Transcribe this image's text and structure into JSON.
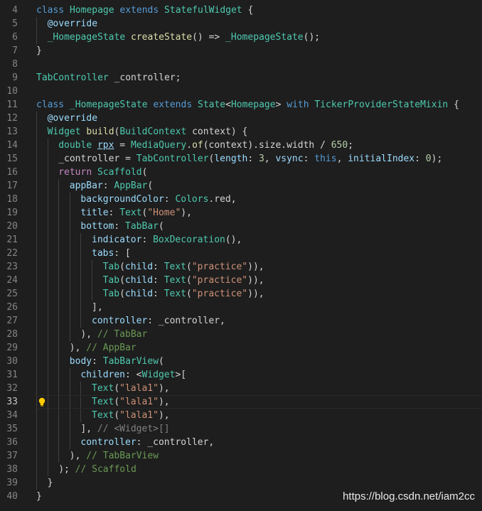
{
  "editor": {
    "theme": "dark",
    "colors": {
      "background": "#1e1e1e",
      "keyword": "#569cd6",
      "control": "#c586c0",
      "class": "#4ec9b0",
      "function": "#dcdcaa",
      "variable": "#9cdcfe",
      "string": "#ce9178",
      "number": "#b5cea8",
      "comment": "#6a9955",
      "hint": "#808080"
    },
    "active_line": 33,
    "lightbulb_icon": "lightbulb-icon",
    "lines": [
      {
        "n": "4",
        "indent": 0,
        "tokens": [
          [
            "keyword",
            "class "
          ],
          [
            "class",
            "Homepage "
          ],
          [
            "keyword",
            "extends "
          ],
          [
            "class",
            "StatefulWidget "
          ],
          [
            "plain",
            "{"
          ]
        ]
      },
      {
        "n": "5",
        "indent": 1,
        "tokens": [
          [
            "anno",
            "@override"
          ]
        ]
      },
      {
        "n": "6",
        "indent": 1,
        "tokens": [
          [
            "class",
            "_HomepageState "
          ],
          [
            "func",
            "createState"
          ],
          [
            "plain",
            "() => "
          ],
          [
            "class",
            "_HomepageState"
          ],
          [
            "plain",
            "();"
          ]
        ]
      },
      {
        "n": "7",
        "indent": 0,
        "tokens": [
          [
            "plain",
            "}"
          ]
        ]
      },
      {
        "n": "8",
        "indent": 0,
        "tokens": []
      },
      {
        "n": "9",
        "indent": 0,
        "tokens": [
          [
            "class",
            "TabController "
          ],
          [
            "plain",
            "_controller;"
          ]
        ]
      },
      {
        "n": "10",
        "indent": 0,
        "tokens": []
      },
      {
        "n": "11",
        "indent": 0,
        "tokens": [
          [
            "keyword",
            "class "
          ],
          [
            "class",
            "_HomepageState "
          ],
          [
            "keyword",
            "extends "
          ],
          [
            "class",
            "State"
          ],
          [
            "plain",
            "<"
          ],
          [
            "class",
            "Homepage"
          ],
          [
            "plain",
            "> "
          ],
          [
            "keyword",
            "with "
          ],
          [
            "class",
            "TickerProviderStateMixin "
          ],
          [
            "plain",
            "{"
          ]
        ]
      },
      {
        "n": "12",
        "indent": 1,
        "tokens": [
          [
            "anno",
            "@override"
          ]
        ]
      },
      {
        "n": "13",
        "indent": 1,
        "tokens": [
          [
            "class",
            "Widget "
          ],
          [
            "func",
            "build"
          ],
          [
            "plain",
            "("
          ],
          [
            "class",
            "BuildContext "
          ],
          [
            "plain",
            "context) {"
          ]
        ]
      },
      {
        "n": "14",
        "indent": 2,
        "tokens": [
          [
            "class",
            "double "
          ],
          [
            "var",
            "rpx"
          ],
          [
            "plain",
            " = "
          ],
          [
            "class",
            "MediaQuery"
          ],
          [
            "plain",
            "."
          ],
          [
            "func",
            "of"
          ],
          [
            "plain",
            "(context).size.width / "
          ],
          [
            "number",
            "650"
          ],
          [
            "plain",
            ";"
          ]
        ]
      },
      {
        "n": "15",
        "indent": 2,
        "tokens": [
          [
            "plain",
            "_controller = "
          ],
          [
            "class",
            "TabController"
          ],
          [
            "plain",
            "("
          ],
          [
            "var",
            "length"
          ],
          [
            "plain",
            ": "
          ],
          [
            "number",
            "3"
          ],
          [
            "plain",
            ", "
          ],
          [
            "var",
            "vsync"
          ],
          [
            "plain",
            ": "
          ],
          [
            "keyword",
            "this"
          ],
          [
            "plain",
            ", "
          ],
          [
            "var",
            "initialIndex"
          ],
          [
            "plain",
            ": "
          ],
          [
            "number",
            "0"
          ],
          [
            "plain",
            ");"
          ]
        ]
      },
      {
        "n": "16",
        "indent": 2,
        "tokens": [
          [
            "control",
            "return "
          ],
          [
            "class",
            "Scaffold"
          ],
          [
            "plain",
            "("
          ]
        ]
      },
      {
        "n": "17",
        "indent": 3,
        "tokens": [
          [
            "var",
            "appBar"
          ],
          [
            "plain",
            ": "
          ],
          [
            "class",
            "AppBar"
          ],
          [
            "plain",
            "("
          ]
        ]
      },
      {
        "n": "18",
        "indent": 4,
        "tokens": [
          [
            "var",
            "backgroundColor"
          ],
          [
            "plain",
            ": "
          ],
          [
            "class",
            "Colors"
          ],
          [
            "plain",
            ".red,"
          ]
        ]
      },
      {
        "n": "19",
        "indent": 4,
        "tokens": [
          [
            "var",
            "title"
          ],
          [
            "plain",
            ": "
          ],
          [
            "class",
            "Text"
          ],
          [
            "plain",
            "("
          ],
          [
            "string",
            "\"Home\""
          ],
          [
            "plain",
            "),"
          ]
        ]
      },
      {
        "n": "20",
        "indent": 4,
        "tokens": [
          [
            "var",
            "bottom"
          ],
          [
            "plain",
            ": "
          ],
          [
            "class",
            "TabBar"
          ],
          [
            "plain",
            "("
          ]
        ]
      },
      {
        "n": "21",
        "indent": 5,
        "tokens": [
          [
            "var",
            "indicator"
          ],
          [
            "plain",
            ": "
          ],
          [
            "class",
            "BoxDecoration"
          ],
          [
            "plain",
            "(),"
          ]
        ]
      },
      {
        "n": "22",
        "indent": 5,
        "tokens": [
          [
            "var",
            "tabs"
          ],
          [
            "plain",
            ": ["
          ]
        ]
      },
      {
        "n": "23",
        "indent": 6,
        "tokens": [
          [
            "class",
            "Tab"
          ],
          [
            "plain",
            "("
          ],
          [
            "var",
            "child"
          ],
          [
            "plain",
            ": "
          ],
          [
            "class",
            "Text"
          ],
          [
            "plain",
            "("
          ],
          [
            "string",
            "\"practice\""
          ],
          [
            "plain",
            ")),"
          ]
        ]
      },
      {
        "n": "24",
        "indent": 6,
        "tokens": [
          [
            "class",
            "Tab"
          ],
          [
            "plain",
            "("
          ],
          [
            "var",
            "child"
          ],
          [
            "plain",
            ": "
          ],
          [
            "class",
            "Text"
          ],
          [
            "plain",
            "("
          ],
          [
            "string",
            "\"practice\""
          ],
          [
            "plain",
            ")),"
          ]
        ]
      },
      {
        "n": "25",
        "indent": 6,
        "tokens": [
          [
            "class",
            "Tab"
          ],
          [
            "plain",
            "("
          ],
          [
            "var",
            "child"
          ],
          [
            "plain",
            ": "
          ],
          [
            "class",
            "Text"
          ],
          [
            "plain",
            "("
          ],
          [
            "string",
            "\"practice\""
          ],
          [
            "plain",
            ")),"
          ]
        ]
      },
      {
        "n": "26",
        "indent": 5,
        "tokens": [
          [
            "plain",
            "],"
          ]
        ]
      },
      {
        "n": "27",
        "indent": 5,
        "tokens": [
          [
            "var",
            "controller"
          ],
          [
            "plain",
            ": _controller,"
          ]
        ]
      },
      {
        "n": "28",
        "indent": 4,
        "tokens": [
          [
            "plain",
            "), "
          ],
          [
            "comment",
            "// TabBar"
          ]
        ]
      },
      {
        "n": "29",
        "indent": 3,
        "tokens": [
          [
            "plain",
            "), "
          ],
          [
            "comment",
            "// AppBar"
          ]
        ]
      },
      {
        "n": "30",
        "indent": 3,
        "tokens": [
          [
            "var",
            "body"
          ],
          [
            "plain",
            ": "
          ],
          [
            "class",
            "TabBarView"
          ],
          [
            "plain",
            "("
          ]
        ]
      },
      {
        "n": "31",
        "indent": 4,
        "tokens": [
          [
            "var",
            "children"
          ],
          [
            "plain",
            ": <"
          ],
          [
            "class",
            "Widget"
          ],
          [
            "plain",
            ">["
          ]
        ]
      },
      {
        "n": "32",
        "indent": 5,
        "tokens": [
          [
            "class",
            "Text"
          ],
          [
            "plain",
            "("
          ],
          [
            "string",
            "\"lala1\""
          ],
          [
            "plain",
            "),"
          ]
        ]
      },
      {
        "n": "33",
        "indent": 5,
        "tokens": [
          [
            "class",
            "Text"
          ],
          [
            "plain",
            "("
          ],
          [
            "string",
            "\"lala1\""
          ],
          [
            "plain",
            "),"
          ]
        ]
      },
      {
        "n": "34",
        "indent": 5,
        "tokens": [
          [
            "class",
            "Text"
          ],
          [
            "plain",
            "("
          ],
          [
            "string",
            "\"lala1\""
          ],
          [
            "plain",
            "),"
          ]
        ]
      },
      {
        "n": "35",
        "indent": 4,
        "tokens": [
          [
            "plain",
            "], "
          ],
          [
            "hint",
            "// <Widget>[]"
          ]
        ]
      },
      {
        "n": "36",
        "indent": 4,
        "tokens": [
          [
            "var",
            "controller"
          ],
          [
            "plain",
            ": _controller,"
          ]
        ]
      },
      {
        "n": "37",
        "indent": 3,
        "tokens": [
          [
            "plain",
            "), "
          ],
          [
            "comment",
            "// TabBarView"
          ]
        ]
      },
      {
        "n": "38",
        "indent": 2,
        "tokens": [
          [
            "plain",
            "); "
          ],
          [
            "comment",
            "// Scaffold"
          ]
        ]
      },
      {
        "n": "39",
        "indent": 1,
        "tokens": [
          [
            "plain",
            "}"
          ]
        ]
      },
      {
        "n": "40",
        "indent": 0,
        "tokens": [
          [
            "plain",
            "}"
          ]
        ]
      }
    ]
  },
  "watermark": "https://blog.csdn.net/iam2cc"
}
